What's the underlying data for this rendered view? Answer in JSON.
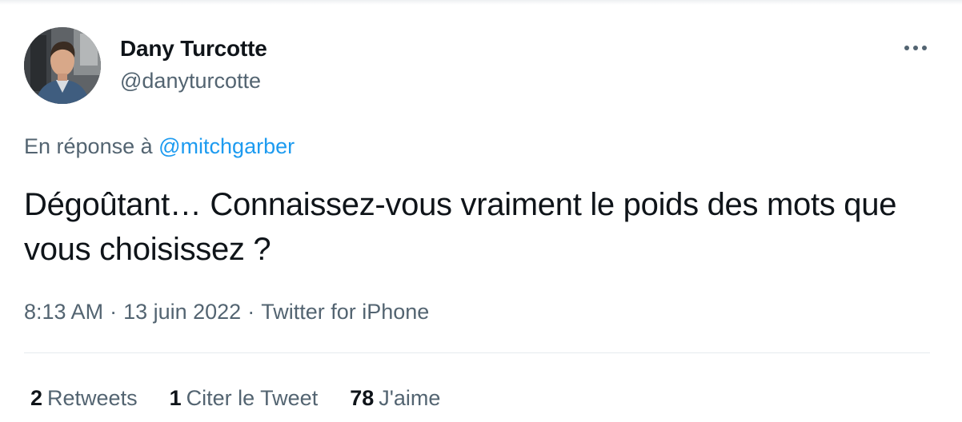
{
  "author": {
    "name": "Dany Turcotte",
    "handle": "@danyturcotte"
  },
  "reply": {
    "prefix": "En réponse à",
    "mention": "@mitchgarber"
  },
  "tweet": {
    "text": "Dégoûtant… Connaissez-vous vraiment le poids des mots que vous choisissez ?"
  },
  "meta": {
    "time": "8:13 AM",
    "separator": "·",
    "date": "13 juin 2022",
    "source": "Twitter for iPhone"
  },
  "stats": {
    "retweets_count": "2",
    "retweets_label": "Retweets",
    "quotes_count": "1",
    "quotes_label": "Citer le Tweet",
    "likes_count": "78",
    "likes_label": "J'aime"
  },
  "colors": {
    "text": "#0f1419",
    "secondary": "#536471",
    "link": "#1d9bf0",
    "divider": "#e6ebee"
  },
  "icons": {
    "more": "more-horizontal-icon"
  }
}
